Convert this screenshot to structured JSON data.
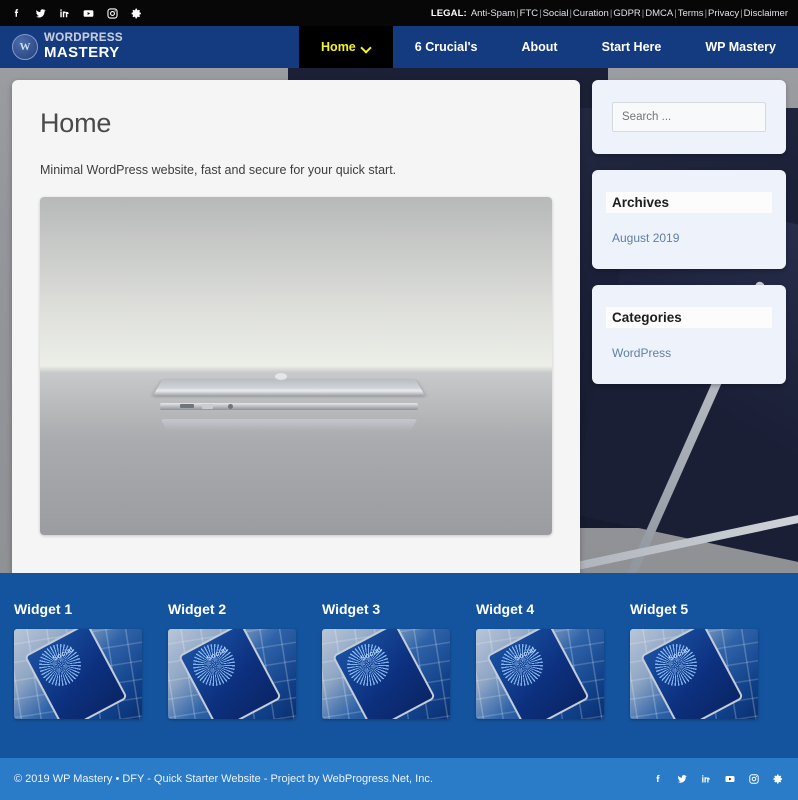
{
  "topbar": {
    "social_icons": [
      {
        "name": "facebook-icon",
        "label": "Facebook"
      },
      {
        "name": "twitter-icon",
        "label": "Twitter"
      },
      {
        "name": "linkedin-icon",
        "label": "LinkedIn"
      },
      {
        "name": "youtube-icon",
        "label": "YouTube"
      },
      {
        "name": "instagram-icon",
        "label": "Instagram"
      },
      {
        "name": "gear-icon",
        "label": "Settings"
      }
    ],
    "legal_label": "LEGAL:",
    "legal_links": [
      "Anti-Spam",
      "FTC",
      "Social",
      "Curation",
      "GDPR",
      "DMCA",
      "Terms",
      "Privacy",
      "Disclaimer"
    ],
    "separator": "|"
  },
  "brand": {
    "badge_text": "W",
    "line1": "WORDPRESS",
    "line2": "MASTERY"
  },
  "nav": {
    "items": [
      {
        "label": "Home",
        "active": true,
        "has_dropdown": true
      },
      {
        "label": "6 Crucial's",
        "active": false,
        "has_dropdown": false
      },
      {
        "label": "About",
        "active": false,
        "has_dropdown": false
      },
      {
        "label": "Start Here",
        "active": false,
        "has_dropdown": false
      },
      {
        "label": "WP Mastery",
        "active": false,
        "has_dropdown": false
      }
    ]
  },
  "article": {
    "title": "Home",
    "tagline": "Minimal WordPress website, fast and secure for your quick start.",
    "image_alt": "Silver laptop closed on reflective surface"
  },
  "sidebar": {
    "search": {
      "placeholder": "Search ...",
      "value": ""
    },
    "widgets": [
      {
        "title": "Archives",
        "links": [
          "August 2019"
        ]
      },
      {
        "title": "Categories",
        "links": [
          "WordPress"
        ]
      }
    ]
  },
  "widget_band": {
    "columns": [
      {
        "title": "Widget 1",
        "thumb_label": "Social"
      },
      {
        "title": "Widget 2",
        "thumb_label": "Social"
      },
      {
        "title": "Widget 3",
        "thumb_label": "Social"
      },
      {
        "title": "Widget 4",
        "thumb_label": "Social"
      },
      {
        "title": "Widget 5",
        "thumb_label": "Social"
      }
    ]
  },
  "footer": {
    "copyright": "© 2019 WP Mastery • DFY - Quick Starter Website - Project by WebProgress.Net, Inc.",
    "social_icons": [
      {
        "name": "facebook-icon",
        "label": "Facebook"
      },
      {
        "name": "twitter-icon",
        "label": "Twitter"
      },
      {
        "name": "linkedin-icon",
        "label": "LinkedIn"
      },
      {
        "name": "youtube-icon",
        "label": "YouTube"
      },
      {
        "name": "instagram-icon",
        "label": "Instagram"
      },
      {
        "name": "gear-icon",
        "label": "Settings"
      }
    ]
  },
  "colors": {
    "topbar_bg": "#070707",
    "nav_bg": "#143a80",
    "nav_active_bg": "#000000",
    "nav_active_text": "#f2f22a",
    "widget_band_bg": "#14549f",
    "footer_bg": "#2a7bc8",
    "card_bg": "#f5f5f5",
    "sidebar_widget_bg": "#eef3fb",
    "link_color": "#5f7fa8"
  }
}
